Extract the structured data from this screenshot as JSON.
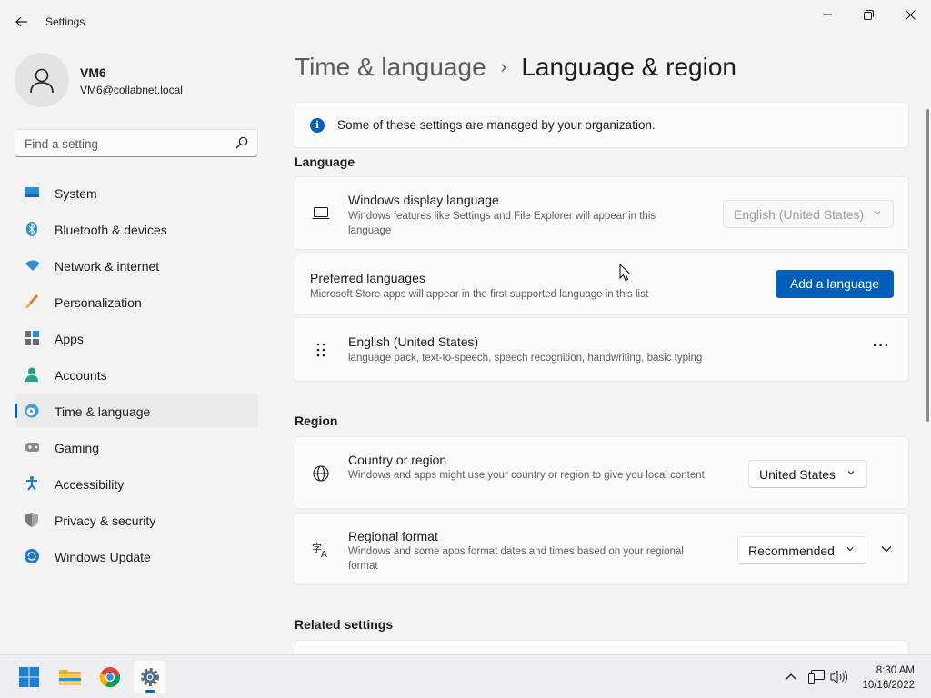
{
  "window": {
    "title": "Settings"
  },
  "profile": {
    "name": "VM6",
    "email": "VM6@collabnet.local"
  },
  "search": {
    "placeholder": "Find a setting"
  },
  "sidebar": {
    "items": [
      {
        "label": "System",
        "icon": "system-icon"
      },
      {
        "label": "Bluetooth & devices",
        "icon": "bluetooth-icon"
      },
      {
        "label": "Network & internet",
        "icon": "wifi-icon"
      },
      {
        "label": "Personalization",
        "icon": "brush-icon"
      },
      {
        "label": "Apps",
        "icon": "apps-icon"
      },
      {
        "label": "Accounts",
        "icon": "accounts-icon"
      },
      {
        "label": "Time & language",
        "icon": "time-language-icon",
        "active": true
      },
      {
        "label": "Gaming",
        "icon": "gamepad-icon"
      },
      {
        "label": "Accessibility",
        "icon": "accessibility-icon"
      },
      {
        "label": "Privacy & security",
        "icon": "shield-icon"
      },
      {
        "label": "Windows Update",
        "icon": "update-icon"
      }
    ]
  },
  "breadcrumb": {
    "parent": "Time & language",
    "separator": "›",
    "current": "Language & region"
  },
  "info": {
    "text": "Some of these settings are managed by your organization."
  },
  "language": {
    "section_title": "Language",
    "display": {
      "title": "Windows display language",
      "desc": "Windows features like Settings and File Explorer will appear in this language",
      "value": "English (United States)"
    },
    "preferred": {
      "title": "Preferred languages",
      "desc": "Microsoft Store apps will appear in the first supported language in this list",
      "button": "Add a language"
    },
    "installed": {
      "title": "English (United States)",
      "desc": "language pack, text-to-speech, speech recognition, handwriting, basic typing",
      "more": "···"
    }
  },
  "region": {
    "section_title": "Region",
    "country": {
      "title": "Country or region",
      "desc": "Windows and apps might use your country or region to give you local content",
      "value": "United States"
    },
    "format": {
      "title": "Regional format",
      "desc": "Windows and some apps format dates and times based on your regional format",
      "value": "Recommended"
    }
  },
  "related": {
    "section_title": "Related settings"
  },
  "taskbar": {
    "apps": [
      "windows-start-icon",
      "file-explorer-icon",
      "chrome-icon",
      "settings-icon"
    ],
    "time": "8:30 AM",
    "date": "10/16/2022"
  },
  "colors": {
    "accent": "#005fb8",
    "background": "#f3f3f3",
    "card": "#fbfbfb"
  }
}
